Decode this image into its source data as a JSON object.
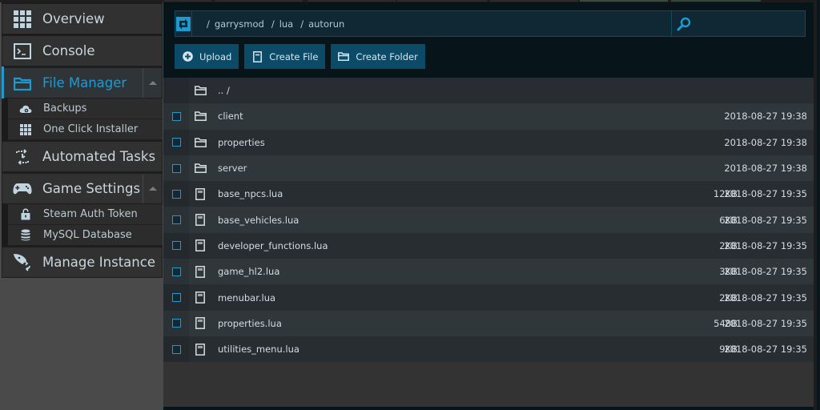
{
  "sidebar": {
    "items": [
      {
        "label": "Overview",
        "icon": "grid-icon"
      },
      {
        "label": "Console",
        "icon": "terminal-icon"
      },
      {
        "label": "File Manager",
        "icon": "folder-icon",
        "active": true,
        "expanded": true,
        "children": [
          {
            "label": "Backups",
            "icon": "cloud-backup-icon"
          },
          {
            "label": "One Click Installer",
            "icon": "grid-icon"
          }
        ]
      },
      {
        "label": "Automated Tasks",
        "icon": "scheduled-task-icon"
      },
      {
        "label": "Game Settings",
        "icon": "gamepad-icon",
        "expanded": true,
        "children": [
          {
            "label": "Steam Auth Token",
            "icon": "lock-icon"
          },
          {
            "label": "MySQL Database",
            "icon": "database-icon"
          }
        ]
      },
      {
        "label": "Manage Instance",
        "icon": "rocket-icon"
      }
    ]
  },
  "pathbar": {
    "refresh_icon": "refresh-icon",
    "separator": "/",
    "crumbs": [
      "garrysmod",
      "lua",
      "autorun"
    ],
    "search_placeholder": "",
    "search_value": ""
  },
  "actions": {
    "upload": "Upload",
    "create_file": "Create File",
    "create_folder": "Create Folder"
  },
  "files": {
    "parent": ".. /",
    "rows": [
      {
        "name": "client",
        "type": "folder",
        "size": "",
        "modified": "2018-08-27 19:38"
      },
      {
        "name": "properties",
        "type": "folder",
        "size": "",
        "modified": "2018-08-27 19:38"
      },
      {
        "name": "server",
        "type": "folder",
        "size": "",
        "modified": "2018-08-27 19:38"
      },
      {
        "name": "base_npcs.lua",
        "type": "file",
        "size": "12KB",
        "modified": "2018-08-27 19:35"
      },
      {
        "name": "base_vehicles.lua",
        "type": "file",
        "size": "6KB",
        "modified": "2018-08-27 19:35"
      },
      {
        "name": "developer_functions.lua",
        "type": "file",
        "size": "2KB",
        "modified": "2018-08-27 19:35"
      },
      {
        "name": "game_hl2.lua",
        "type": "file",
        "size": "3KB",
        "modified": "2018-08-27 19:35"
      },
      {
        "name": "menubar.lua",
        "type": "file",
        "size": "2KB",
        "modified": "2018-08-27 19:35"
      },
      {
        "name": "properties.lua",
        "type": "file",
        "size": "548B",
        "modified": "2018-08-27 19:35"
      },
      {
        "name": "utilities_menu.lua",
        "type": "file",
        "size": "9KB",
        "modified": "2018-08-27 19:35"
      }
    ]
  },
  "colors": {
    "accent": "#1d9bd1",
    "button_bg": "#0c4b68",
    "pathbar_bg": "#0f2834"
  }
}
